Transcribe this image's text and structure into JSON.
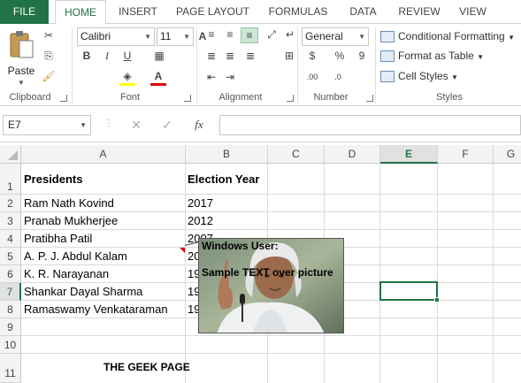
{
  "tabs": {
    "file": "FILE",
    "items": [
      "HOME",
      "INSERT",
      "PAGE LAYOUT",
      "FORMULAS",
      "DATA",
      "REVIEW",
      "VIEW"
    ]
  },
  "ribbon": {
    "clipboard": {
      "paste_label": "Paste",
      "group_label": "Clipboard"
    },
    "font": {
      "name": "Calibri",
      "size": "11",
      "group_label": "Font",
      "bold": "B",
      "italic": "I",
      "underline": "U"
    },
    "alignment": {
      "group_label": "Alignment"
    },
    "number": {
      "format": "General",
      "percent": "%",
      "comma": "9",
      "group_label": "Number"
    },
    "styles": {
      "conditional": "Conditional Formatting",
      "format_table": "Format as Table",
      "cell_styles": "Cell Styles",
      "group_label": "Styles"
    }
  },
  "formula_bar": {
    "name_box": "E7",
    "fx": "fx",
    "value": ""
  },
  "columns": [
    "A",
    "B",
    "C",
    "D",
    "E",
    "F",
    "G"
  ],
  "selected_column": "E",
  "rows": [
    "1",
    "2",
    "3",
    "4",
    "5",
    "6",
    "7",
    "8",
    "9",
    "10",
    "11"
  ],
  "selected_row": "7",
  "table": {
    "header": [
      "Presidents",
      "Election Year"
    ],
    "data": [
      [
        "Ram Nath Kovind",
        "2017"
      ],
      [
        "Pranab Mukherjee",
        "2012"
      ],
      [
        "Pratibha Patil",
        "2007"
      ],
      [
        "A. P. J. Abdul Kalam",
        "20"
      ],
      [
        "K. R. Narayanan",
        "19"
      ],
      [
        "Shankar Dayal Sharma",
        "19"
      ],
      [
        "Ramaswamy Venkataraman",
        "19"
      ]
    ],
    "footer": "THE GEEK PAGE"
  },
  "picture": {
    "comment_author": "Windows User:",
    "overlay_text": "Sample TEXT over picture"
  },
  "colors": {
    "accent": "#217346"
  }
}
